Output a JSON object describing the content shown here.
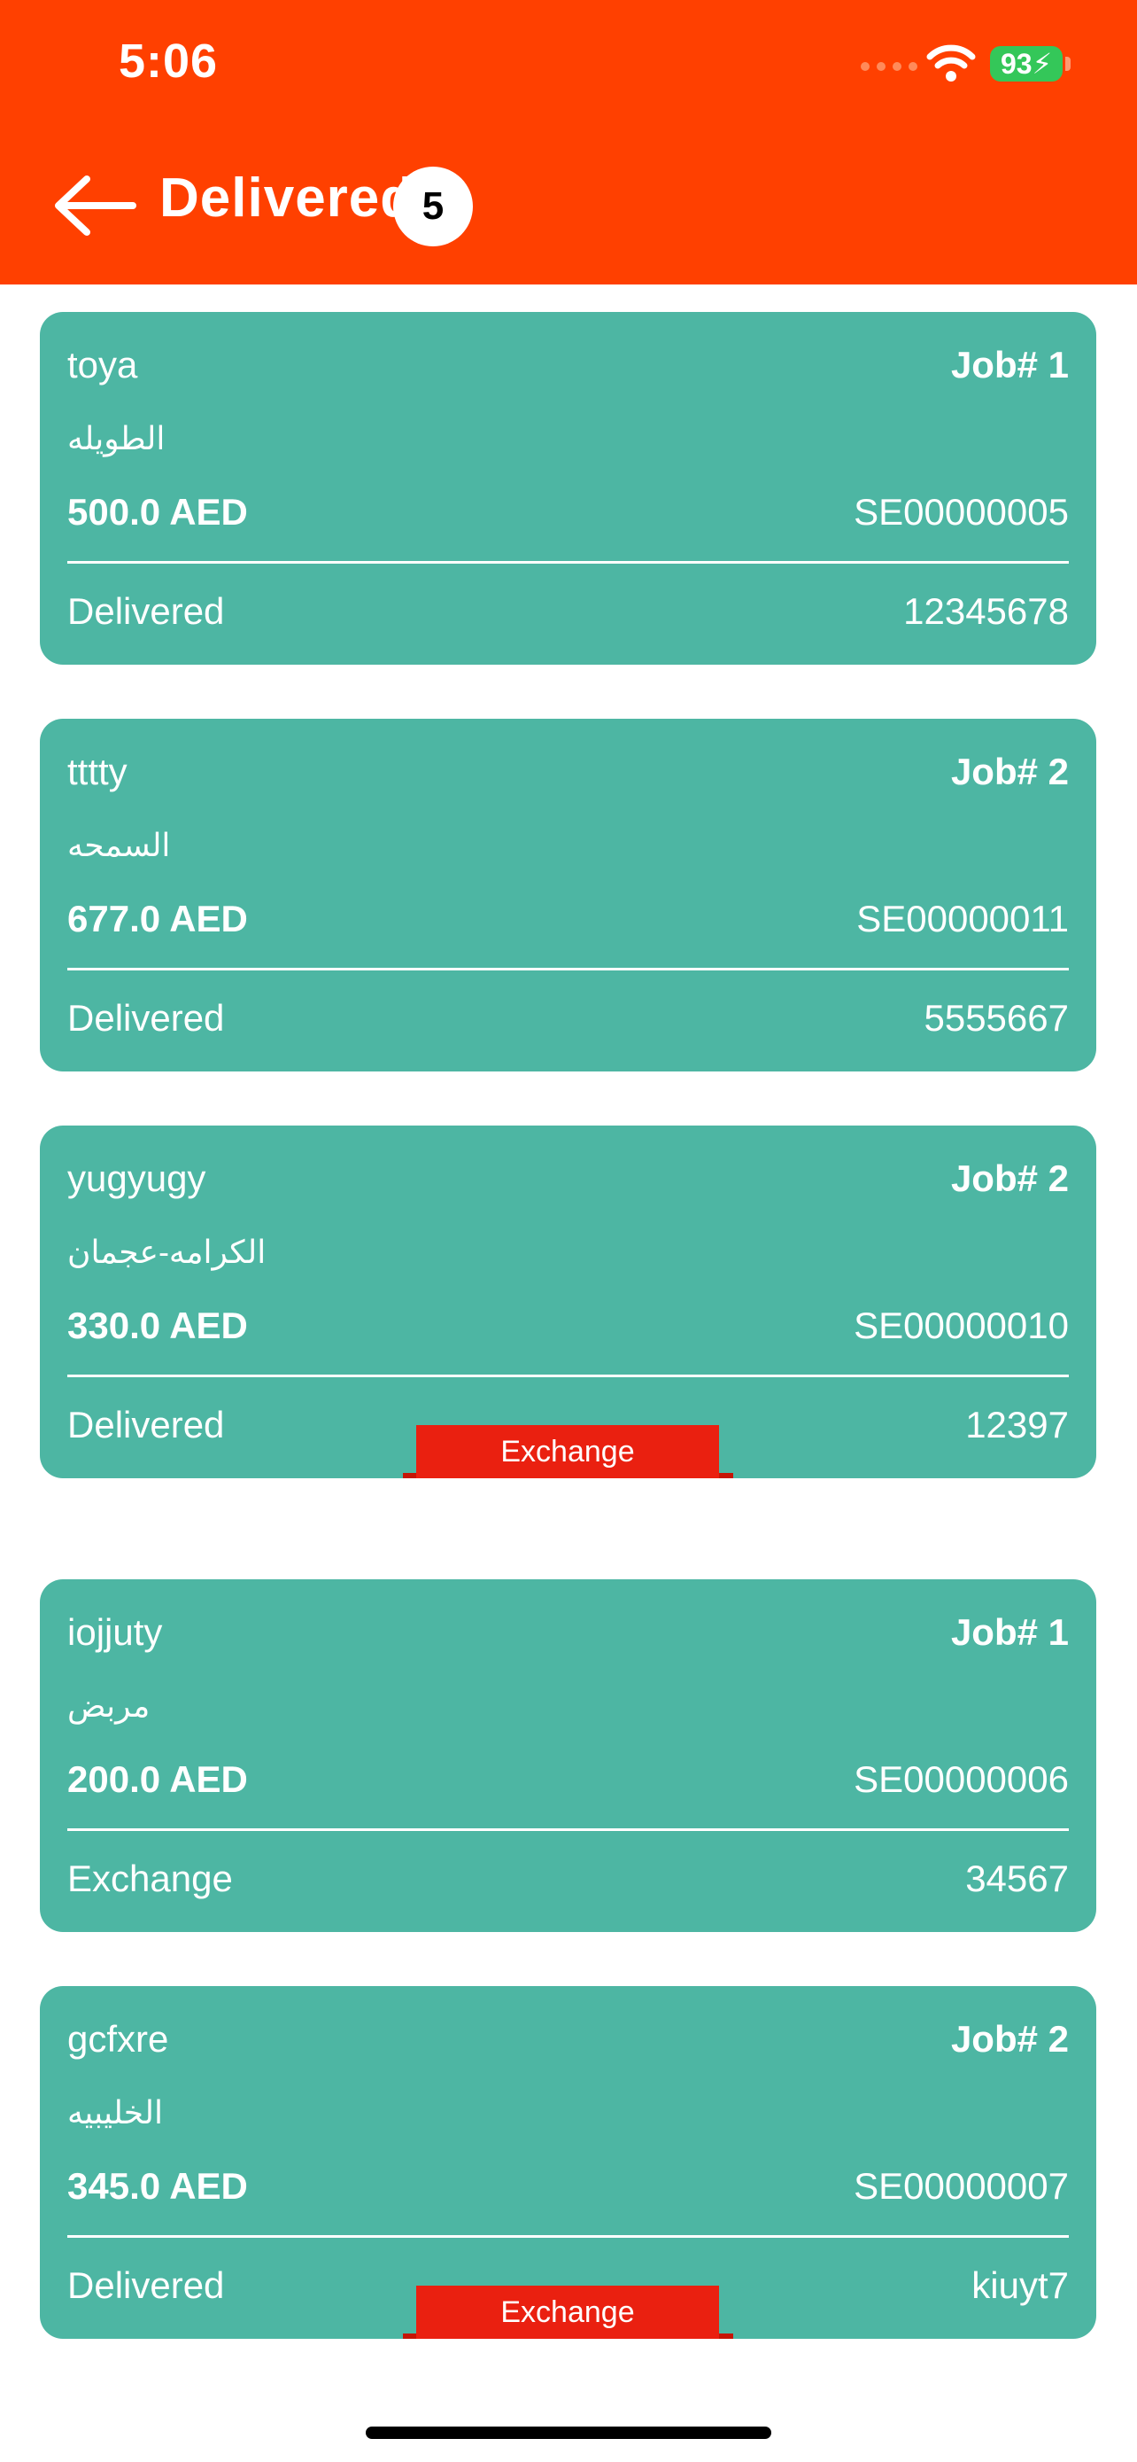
{
  "status_bar": {
    "time": "5:06",
    "battery": "93"
  },
  "header": {
    "title": "Delivered",
    "count": "5"
  },
  "jobs": [
    {
      "name": "toya",
      "job": "Job# 1",
      "area": "الطويله",
      "amount": "500.0 AED",
      "code": "SE00000005",
      "status": "Delivered",
      "ref": "12345678"
    },
    {
      "name": "tttty",
      "job": "Job# 2",
      "area": "السمحه",
      "amount": "677.0 AED",
      "code": "SE00000011",
      "status": "Delivered",
      "ref": "5555667"
    },
    {
      "name": "yugyugy",
      "job": "Job# 2",
      "area": "الكرامه-عجمان",
      "amount": "330.0 AED",
      "code": "SE00000010",
      "status": "Delivered",
      "ref": "12397",
      "badge": "Exchange"
    },
    {
      "name": "iojjuty",
      "job": "Job# 1",
      "area": "مربض",
      "amount": "200.0 AED",
      "code": "SE00000006",
      "status": "Exchange",
      "ref": "34567"
    },
    {
      "name": "gcfxre",
      "job": "Job# 2",
      "area": "الخليبيه",
      "amount": "345.0 AED",
      "code": "SE00000007",
      "status": "Delivered",
      "ref": "kiuyt7",
      "badge": "Exchange"
    }
  ]
}
